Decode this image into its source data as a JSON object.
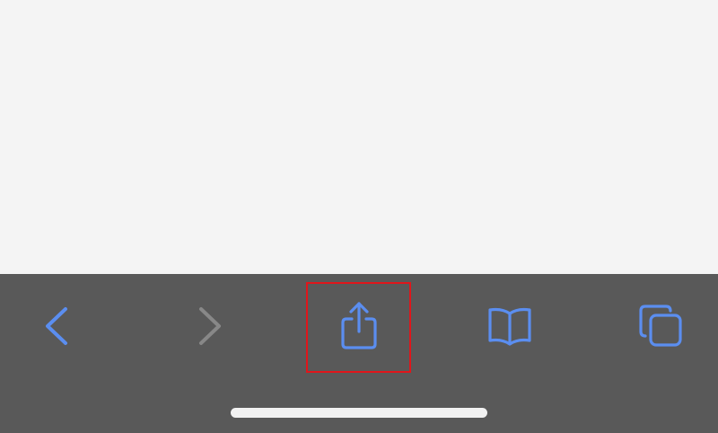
{
  "toolbar": {
    "buttons": [
      {
        "id": "back",
        "icon": "chevron-left-icon",
        "enabled": true
      },
      {
        "id": "forward",
        "icon": "chevron-right-icon",
        "enabled": false
      },
      {
        "id": "share",
        "icon": "share-icon",
        "enabled": true,
        "highlighted": true
      },
      {
        "id": "bookmarks",
        "icon": "book-icon",
        "enabled": true
      },
      {
        "id": "tabs",
        "icon": "tabs-icon",
        "enabled": true
      }
    ]
  },
  "colors": {
    "page_background": "#f4f4f4",
    "toolbar_background": "#595959",
    "accent_blue": "#5b8ef0",
    "disabled_gray": "#888888",
    "highlight_red": "#e0161b",
    "home_indicator": "#f2f2f2"
  }
}
